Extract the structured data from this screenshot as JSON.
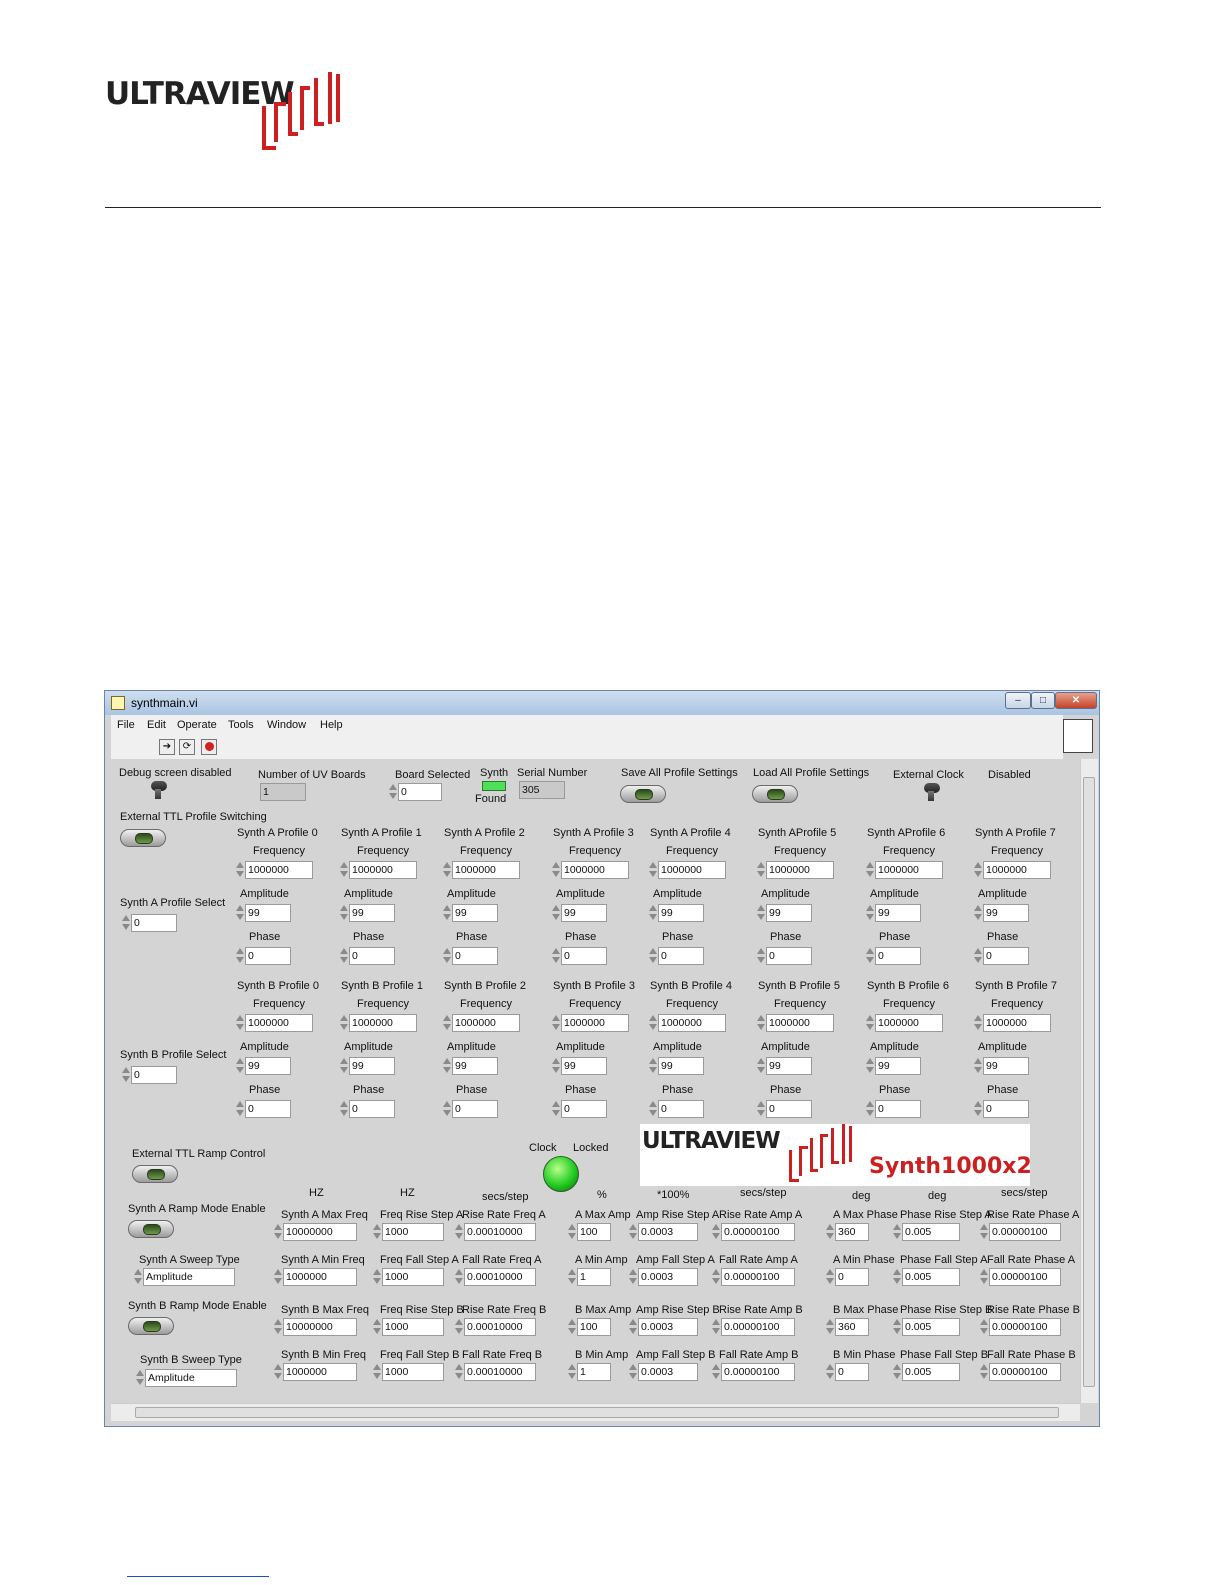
{
  "document": {
    "brand": "ULTRAVIEW"
  },
  "window": {
    "title": "synthmain.vi",
    "controls": {
      "minimize": "–",
      "maximize": "□",
      "close": "✕"
    },
    "menu": [
      "File",
      "Edit",
      "Operate",
      "Tools",
      "Window",
      "Help"
    ],
    "toolbar_icons": [
      "run-arrow-icon",
      "run-continuous-icon",
      "abort-icon"
    ]
  },
  "top": {
    "debug_label": "Debug screen disabled",
    "num_boards_label": "Number of UV Boards",
    "num_boards_value": "1",
    "board_selected_label": "Board Selected",
    "board_selected_value": "0",
    "synth_label": "Synth",
    "found_label": "Found",
    "serial_label": "Serial Number",
    "serial_value": "305",
    "save_label": "Save All Profile Settings",
    "load_label": "Load All Profile Settings",
    "ext_clock_label": "External Clock",
    "ext_clock_state": "Disabled",
    "ttl_switch_label": "External TTL Profile Switching"
  },
  "synth_a": {
    "select_label": "Synth A Profile Select",
    "select_value": "0",
    "profiles": [
      {
        "name": "Synth A Profile 0",
        "frequency": "1000000",
        "amplitude": "99",
        "phase": "0"
      },
      {
        "name": "Synth A Profile 1",
        "frequency": "1000000",
        "amplitude": "99",
        "phase": "0"
      },
      {
        "name": "Synth A Profile 2",
        "frequency": "1000000",
        "amplitude": "99",
        "phase": "0"
      },
      {
        "name": "Synth A Profile 3",
        "frequency": "1000000",
        "amplitude": "99",
        "phase": "0"
      },
      {
        "name": "Synth A Profile 4",
        "frequency": "1000000",
        "amplitude": "99",
        "phase": "0"
      },
      {
        "name": "Synth AProfile 5",
        "frequency": "1000000",
        "amplitude": "99",
        "phase": "0"
      },
      {
        "name": "Synth AProfile 6",
        "frequency": "1000000",
        "amplitude": "99",
        "phase": "0"
      },
      {
        "name": "Synth A Profile 7",
        "frequency": "1000000",
        "amplitude": "99",
        "phase": "0"
      }
    ]
  },
  "synth_b": {
    "select_label": "Synth B Profile Select",
    "select_value": "0",
    "profiles": [
      {
        "name": "Synth B Profile 0",
        "frequency": "1000000",
        "amplitude": "99",
        "phase": "0"
      },
      {
        "name": "Synth B Profile 1",
        "frequency": "1000000",
        "amplitude": "99",
        "phase": "0"
      },
      {
        "name": "Synth B Profile 2",
        "frequency": "1000000",
        "amplitude": "99",
        "phase": "0"
      },
      {
        "name": "Synth B Profile 3",
        "frequency": "1000000",
        "amplitude": "99",
        "phase": "0"
      },
      {
        "name": "Synth B Profile 4",
        "frequency": "1000000",
        "amplitude": "99",
        "phase": "0"
      },
      {
        "name": "Synth B Profile 5",
        "frequency": "1000000",
        "amplitude": "99",
        "phase": "0"
      },
      {
        "name": "Synth B Profile 6",
        "frequency": "1000000",
        "amplitude": "99",
        "phase": "0"
      },
      {
        "name": "Synth B Profile 7",
        "frequency": "1000000",
        "amplitude": "99",
        "phase": "0"
      }
    ]
  },
  "field_labels": {
    "frequency": "Frequency",
    "amplitude": "Amplitude",
    "phase": "Phase"
  },
  "ramp": {
    "ttl_ramp_label": "External TTL Ramp Control",
    "clock_label": "Clock",
    "locked_label": "Locked",
    "product_name": "Synth1000x2",
    "a_enable_label": "Synth A Ramp Mode Enable",
    "a_sweep_label": "Synth A Sweep Type",
    "a_sweep_value": "Amplitude",
    "b_enable_label": "Synth B Ramp Mode Enable",
    "b_sweep_label": "Synth B Sweep Type",
    "b_sweep_value": "Amplitude",
    "units": {
      "hz1": "HZ",
      "hz2": "HZ",
      "secs1": "secs/step",
      "pct": "%",
      "x100": "*100%",
      "secs2": "secs/step",
      "deg1": "deg",
      "deg2": "deg",
      "secs3": "secs/step"
    },
    "rows": [
      {
        "cells": [
          {
            "label": "Synth A Max Freq",
            "value": "10000000"
          },
          {
            "label": "Freq Rise Step A",
            "value": "1000"
          },
          {
            "label": "Rise Rate Freq A",
            "value": "0.00010000"
          },
          {
            "label": "A Max Amp",
            "value": "100"
          },
          {
            "label": "Amp Rise Step A",
            "value": "0.0003"
          },
          {
            "label": "Rise Rate Amp A",
            "value": "0.00000100"
          },
          {
            "label": "A Max Phase",
            "value": "360"
          },
          {
            "label": "Phase Rise Step A",
            "value": "0.005"
          },
          {
            "label": "Rise Rate Phase A",
            "value": "0.00000100"
          }
        ]
      },
      {
        "cells": [
          {
            "label": "Synth A Min Freq",
            "value": "1000000"
          },
          {
            "label": "Freq Fall Step A",
            "value": "1000"
          },
          {
            "label": "Fall Rate Freq A",
            "value": "0.00010000"
          },
          {
            "label": "A Min Amp",
            "value": "1"
          },
          {
            "label": "Amp Fall Step A",
            "value": "0.0003"
          },
          {
            "label": "Fall Rate Amp A",
            "value": "0.00000100"
          },
          {
            "label": "A Min Phase",
            "value": "0"
          },
          {
            "label": "Phase Fall Step A",
            "value": "0.005"
          },
          {
            "label": "Fall Rate Phase A",
            "value": "0.00000100"
          }
        ]
      },
      {
        "cells": [
          {
            "label": "Synth B Max Freq",
            "value": "10000000"
          },
          {
            "label": "Freq Rise Step B",
            "value": "1000"
          },
          {
            "label": "Rise Rate Freq B",
            "value": "0.00010000"
          },
          {
            "label": "B Max Amp",
            "value": "100"
          },
          {
            "label": "Amp Rise Step B",
            "value": "0.0003"
          },
          {
            "label": "Rise Rate Amp B",
            "value": "0.00000100"
          },
          {
            "label": "B Max Phase",
            "value": "360"
          },
          {
            "label": "Phase Rise Step B",
            "value": "0.005"
          },
          {
            "label": "Rise Rate Phase B",
            "value": "0.00000100"
          }
        ]
      },
      {
        "cells": [
          {
            "label": "Synth B Min Freq",
            "value": "1000000"
          },
          {
            "label": "Freq Fall Step B",
            "value": "1000"
          },
          {
            "label": "Fall Rate Freq B",
            "value": "0.00010000"
          },
          {
            "label": "B Min Amp",
            "value": "1"
          },
          {
            "label": "Amp Fall Step B",
            "value": "0.0003"
          },
          {
            "label": "Fall Rate Amp B",
            "value": "0.00000100"
          },
          {
            "label": "B Min Phase",
            "value": "0"
          },
          {
            "label": "Phase Fall Step B",
            "value": "0.005"
          },
          {
            "label": "Fall Rate Phase B",
            "value": "0.00000100"
          }
        ]
      }
    ]
  },
  "colors": {
    "logo_red": "#cc1f1f",
    "panel_bg": "#d4d4d4",
    "led_green": "#22cc22"
  }
}
